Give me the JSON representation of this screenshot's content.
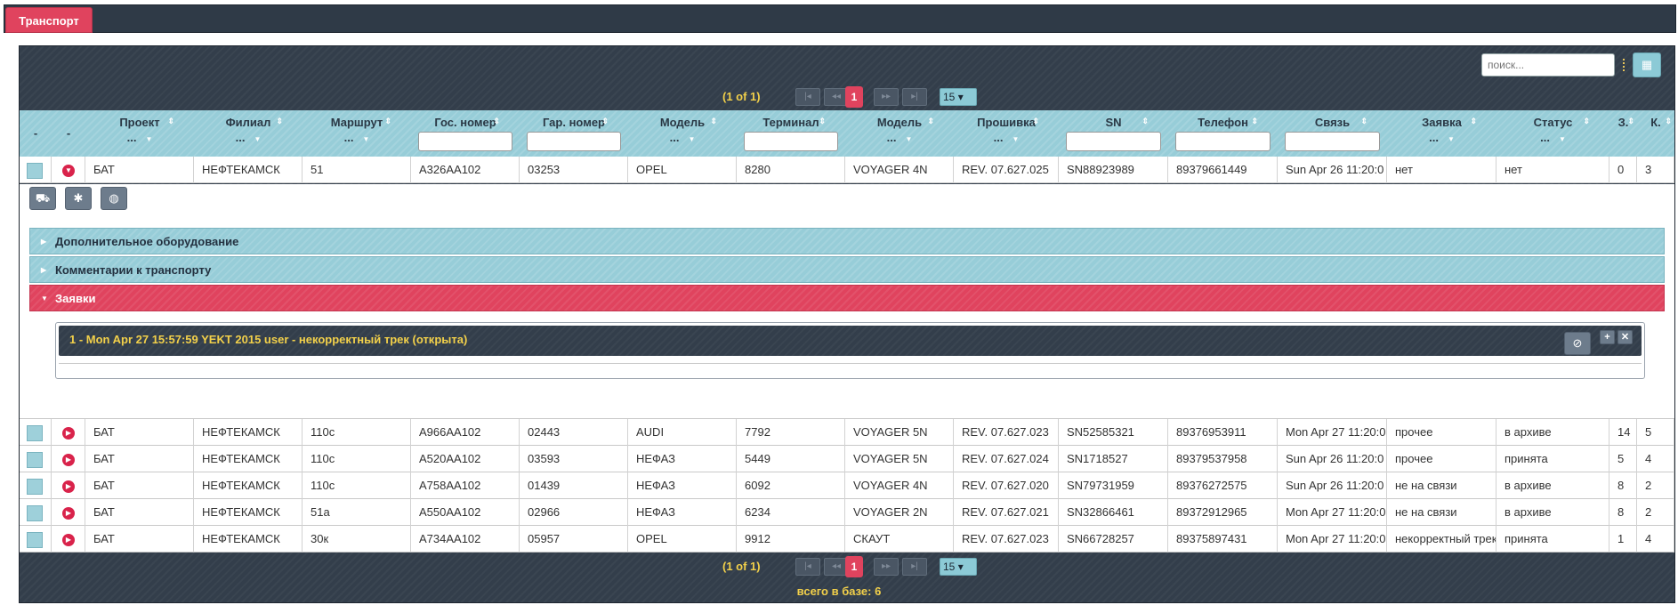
{
  "tab": {
    "label": "Транспорт"
  },
  "toolbar": {
    "search_placeholder": "поиск...",
    "columns_icon": "columns-icon"
  },
  "paginator": {
    "count": "(1 of 1)",
    "page": "1",
    "rows": "15",
    "first": "|◂",
    "prev": "◂◂",
    "next": "▸▸",
    "last": "▸|"
  },
  "footer": {
    "total": "всего в базе: 6"
  },
  "columns": [
    {
      "label": "-"
    },
    {
      "label": "-"
    },
    {
      "label": "Проект",
      "filter": "..."
    },
    {
      "label": "Филиал",
      "filter": "..."
    },
    {
      "label": "Маршрут",
      "filter": "..."
    },
    {
      "label": "Гос. номер"
    },
    {
      "label": "Гар. номер"
    },
    {
      "label": "Модель",
      "filter": "..."
    },
    {
      "label": "Терминал"
    },
    {
      "label": "Модель",
      "filter": "..."
    },
    {
      "label": "Прошивка",
      "filter": "..."
    },
    {
      "label": "SN"
    },
    {
      "label": "Телефон"
    },
    {
      "label": "Связь"
    },
    {
      "label": "Заявка",
      "filter": "..."
    },
    {
      "label": "Статус",
      "filter": "..."
    },
    {
      "label": "З."
    },
    {
      "label": "К."
    }
  ],
  "rows": [
    [
      "БАТ",
      "НЕФТЕКАМСК",
      "51",
      "А326АА102",
      "03253",
      "OPEL",
      "8280",
      "VOYAGER 4N",
      "REV. 07.627.025",
      "SN88923989",
      "89379661449",
      "Sun Apr 26 11:20:0",
      "нет",
      "нет",
      "0",
      "3"
    ],
    [
      "БАТ",
      "НЕФТЕКАМСК",
      "110с",
      "А966АА102",
      "02443",
      "AUDI",
      "7792",
      "VOYAGER 5N",
      "REV. 07.627.023",
      "SN52585321",
      "89376953911",
      "Mon Apr 27 11:20:0",
      "прочее",
      "в архиве",
      "14",
      "5"
    ],
    [
      "БАТ",
      "НЕФТЕКАМСК",
      "110с",
      "А520АА102",
      "03593",
      "НЕФАЗ",
      "5449",
      "VOYAGER 5N",
      "REV. 07.627.024",
      "SN1718527",
      "89379537958",
      "Sun Apr 26 11:20:0",
      "прочее",
      "принята",
      "5",
      "4"
    ],
    [
      "БАТ",
      "НЕФТЕКАМСК",
      "110с",
      "А758АА102",
      "01439",
      "НЕФАЗ",
      "6092",
      "VOYAGER 4N",
      "REV. 07.627.020",
      "SN79731959",
      "89376272575",
      "Sun Apr 26 11:20:0",
      "не на связи",
      "в архиве",
      "8",
      "2"
    ],
    [
      "БАТ",
      "НЕФТЕКАМСК",
      "51а",
      "А550АА102",
      "02966",
      "НЕФАЗ",
      "6234",
      "VOYAGER 2N",
      "REV. 07.627.021",
      "SN32866461",
      "89372912965",
      "Mon Apr 27 11:20:0",
      "не на связи",
      "в архиве",
      "8",
      "2"
    ],
    [
      "БАТ",
      "НЕФТЕКАМСК",
      "30к",
      "А734АА102",
      "05957",
      "OPEL",
      "9912",
      "СКАУТ",
      "REV. 07.627.023",
      "SN66728257",
      "89375897431",
      "Mon Apr 27 11:20:0",
      "некорректный трек",
      "принята",
      "1",
      "4"
    ]
  ],
  "expansion": {
    "actions": [
      {
        "icon": "truck-icon",
        "glyph": "⛟"
      },
      {
        "icon": "bug-icon",
        "glyph": "✱"
      },
      {
        "icon": "globe-icon",
        "glyph": "◍"
      }
    ],
    "accordion": [
      {
        "label": "Дополнительное оборудование",
        "active": false
      },
      {
        "label": "Комментарии к транспорту",
        "active": false
      },
      {
        "label": "Заявки",
        "active": true
      }
    ],
    "request": {
      "title": "1 - Mon Apr 27 15:57:59 YEKT 2015 user - некорректный трек (открыта)",
      "cancel_glyph": "⊘",
      "add_glyph": "+",
      "close_glyph": "✕"
    }
  }
}
